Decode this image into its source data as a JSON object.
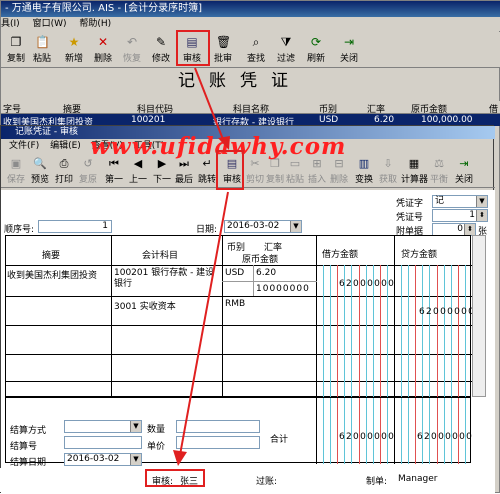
{
  "outer": {
    "title": "- 万通电子有限公司. AIS - [会计分录序时簿]",
    "menu": [
      "具(I)",
      "窗口(W)",
      "帮助(H)"
    ],
    "toolbar": [
      "复制",
      "粘贴",
      "新增",
      "删除",
      "恢复",
      "修改",
      "审核",
      "批审",
      "查找",
      "过滤",
      "刷新",
      "关闭"
    ],
    "grid_headers": [
      "字号",
      "摘要",
      "科目代码",
      "科目名称",
      "币别",
      "汇率",
      "原币金额",
      "借"
    ],
    "grid_row": [
      "",
      "收到美国杰利集团投资",
      "100201",
      "银行存款 - 建设银行",
      "USD",
      "6.20",
      "100,000.00",
      ""
    ]
  },
  "inner": {
    "title": "记账凭证 - 审核",
    "menu": [
      "文件(F)",
      "编辑(E)",
      "查看(V)",
      "工具(T)"
    ],
    "toolbar": [
      "保存",
      "预览",
      "打印",
      "复原",
      "第一",
      "上一",
      "下一",
      "最后",
      "跳转",
      "审核",
      "剪切",
      "复制",
      "粘贴",
      "插入",
      "删除",
      "变换",
      "获取",
      "计算器",
      "平衡",
      "关闭"
    ],
    "watermark": "www.ufidawhy.com",
    "voucher_title": "记账凭证",
    "voucher_word_label": "凭证字",
    "voucher_word": "记",
    "voucher_no_label": "凭证号",
    "voucher_no": "1",
    "attach_label": "附单据",
    "attach_count": "0",
    "attach_unit": "张",
    "seq_label": "顺序号:",
    "seq_value": "1",
    "date_label": "日期:",
    "date_value": "2016-03-02",
    "table_headers": {
      "summary": "摘要",
      "account": "会计科目",
      "currency": "币别",
      "rate": "汇率",
      "orig_amount": "原币金额",
      "debit": "借方金额",
      "credit": "贷方金额"
    },
    "entries": [
      {
        "summary": "收到美国杰利集团投资",
        "account": "100201 银行存款 - 建设银行",
        "currency": "USD",
        "rate": "6.20",
        "orig_amount": "10000000",
        "debit": "62000000",
        "credit": ""
      },
      {
        "summary": "",
        "account": "3001 实收资本",
        "currency": "RMB",
        "rate": "",
        "orig_amount": "",
        "debit": "",
        "credit": "62000000"
      }
    ],
    "settle_method_label": "结算方式",
    "qty_label": "数量",
    "settle_no_label": "结算号",
    "price_label": "单价",
    "settle_date_label": "结算日期",
    "settle_date": "2016-03-02",
    "total_label": "合计",
    "total_debit": "62000000",
    "total_credit": "62000000",
    "auditor_label": "审核:",
    "auditor": "张三",
    "posting_label": "过账:",
    "maker_label": "制单:",
    "maker": "Manager"
  },
  "colors": {
    "highlight": "#e02020",
    "title_bar": "#0a246a",
    "watermark": "#ff2020"
  }
}
